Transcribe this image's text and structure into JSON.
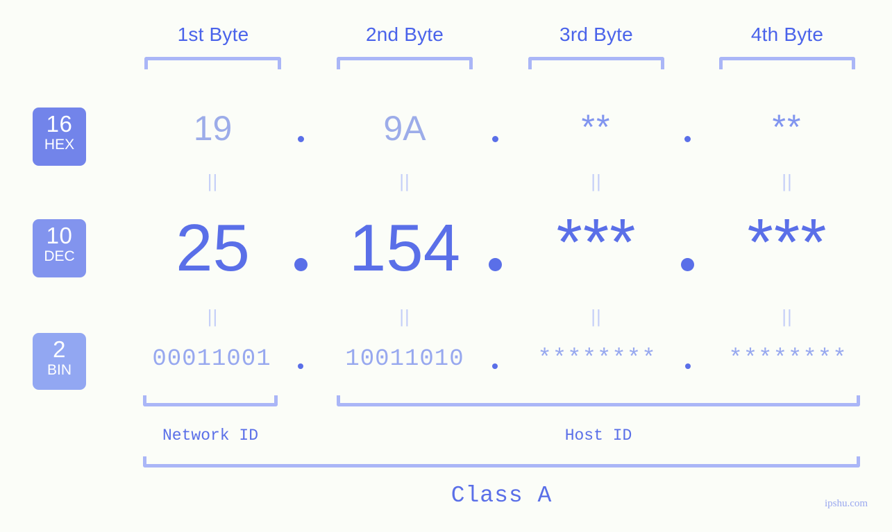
{
  "headers": [
    {
      "label": "1st Byte"
    },
    {
      "label": "2nd Byte"
    },
    {
      "label": "3rd Byte"
    },
    {
      "label": "4th Byte"
    }
  ],
  "rows": {
    "hex": {
      "badge_radix": "16",
      "badge_name": "HEX",
      "badge_color": "#7284ea",
      "values": [
        "19",
        "9A",
        "**",
        "**"
      ],
      "separator": "."
    },
    "dec": {
      "badge_radix": "10",
      "badge_name": "DEC",
      "badge_color": "#8294ee",
      "values": [
        "25",
        "154",
        "***",
        "***"
      ],
      "separator": "."
    },
    "bin": {
      "badge_radix": "2",
      "badge_name": "BIN",
      "badge_color": "#92a7f2",
      "values": [
        "00011001",
        "10011010",
        "********",
        "********"
      ],
      "separator": "."
    }
  },
  "equality_marks": [
    "||",
    "||",
    "||",
    "||"
  ],
  "sections": {
    "network_id": "Network ID",
    "host_id": "Host ID",
    "class": "Class A"
  },
  "watermark": "ipshu.com",
  "colors": {
    "background": "#fbfdf8",
    "accent": "#5a6fe8",
    "accent_light": "#aab6f7",
    "header_text": "#4a63ea",
    "muted": "#c4cef8"
  }
}
